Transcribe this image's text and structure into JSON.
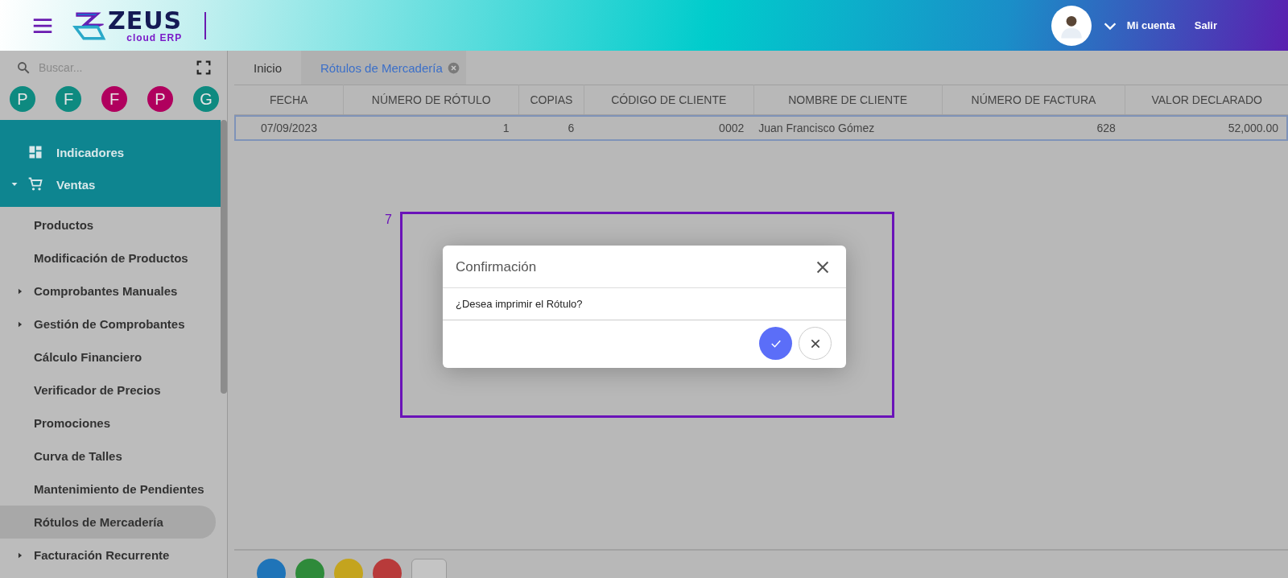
{
  "header": {
    "logo": {
      "name": "ZEUS",
      "subtitle": "cloud ERP"
    },
    "account": "Mi cuenta",
    "logout": "Salir"
  },
  "sidebar": {
    "search": {
      "placeholder": "Buscar..."
    },
    "shortcuts": [
      {
        "letter": "P",
        "color": "#0e8a80"
      },
      {
        "letter": "F",
        "color": "#0e8a80"
      },
      {
        "letter": "F",
        "color": "#b0005e"
      },
      {
        "letter": "P",
        "color": "#b0005e"
      },
      {
        "letter": "G",
        "color": "#0e8a80"
      }
    ],
    "menu": [
      {
        "label": "Indicadores",
        "expanded": false
      },
      {
        "label": "Ventas",
        "expanded": true,
        "children": [
          {
            "label": "Productos",
            "expandable": false,
            "selected": false
          },
          {
            "label": "Modificación de Productos",
            "expandable": false,
            "selected": false
          },
          {
            "label": "Comprobantes Manuales",
            "expandable": true,
            "selected": false
          },
          {
            "label": "Gestión de Comprobantes",
            "expandable": true,
            "selected": false
          },
          {
            "label": "Cálculo Financiero",
            "expandable": false,
            "selected": false
          },
          {
            "label": "Verificador de Precios",
            "expandable": false,
            "selected": false
          },
          {
            "label": "Promociones",
            "expandable": false,
            "selected": false
          },
          {
            "label": "Curva de Talles",
            "expandable": false,
            "selected": false
          },
          {
            "label": "Mantenimiento de Pendientes",
            "expandable": false,
            "selected": false
          },
          {
            "label": "Rótulos de Mercadería",
            "expandable": false,
            "selected": true
          },
          {
            "label": "Facturación Recurrente",
            "expandable": true,
            "selected": false
          }
        ]
      }
    ]
  },
  "tabs": [
    {
      "label": "Inicio",
      "selected": false,
      "closable": false
    },
    {
      "label": "Rótulos de Mercadería",
      "selected": true,
      "closable": true
    }
  ],
  "table": {
    "columns": [
      "FECHA",
      "NÚMERO DE RÓTULO",
      "COPIAS",
      "CÓDIGO DE CLIENTE",
      "NOMBRE DE CLIENTE",
      "NÚMERO DE FACTURA",
      "VALOR DECLARADO"
    ],
    "rows": [
      {
        "selected": true,
        "cells": [
          "07/09/2023",
          "1",
          "6",
          "0002",
          "Juan Francisco Gómez",
          "628",
          "52,000.00"
        ]
      }
    ]
  },
  "annotation": {
    "label": "7"
  },
  "dialog": {
    "title": "Confirmación",
    "message": "¿Desea imprimir el Rótulo?"
  },
  "bottom_buttons": [
    {
      "color": "#1f74b8"
    },
    {
      "color": "#2e8a3a"
    },
    {
      "color": "#c4a41e"
    },
    {
      "color": "#b83a3a"
    }
  ]
}
